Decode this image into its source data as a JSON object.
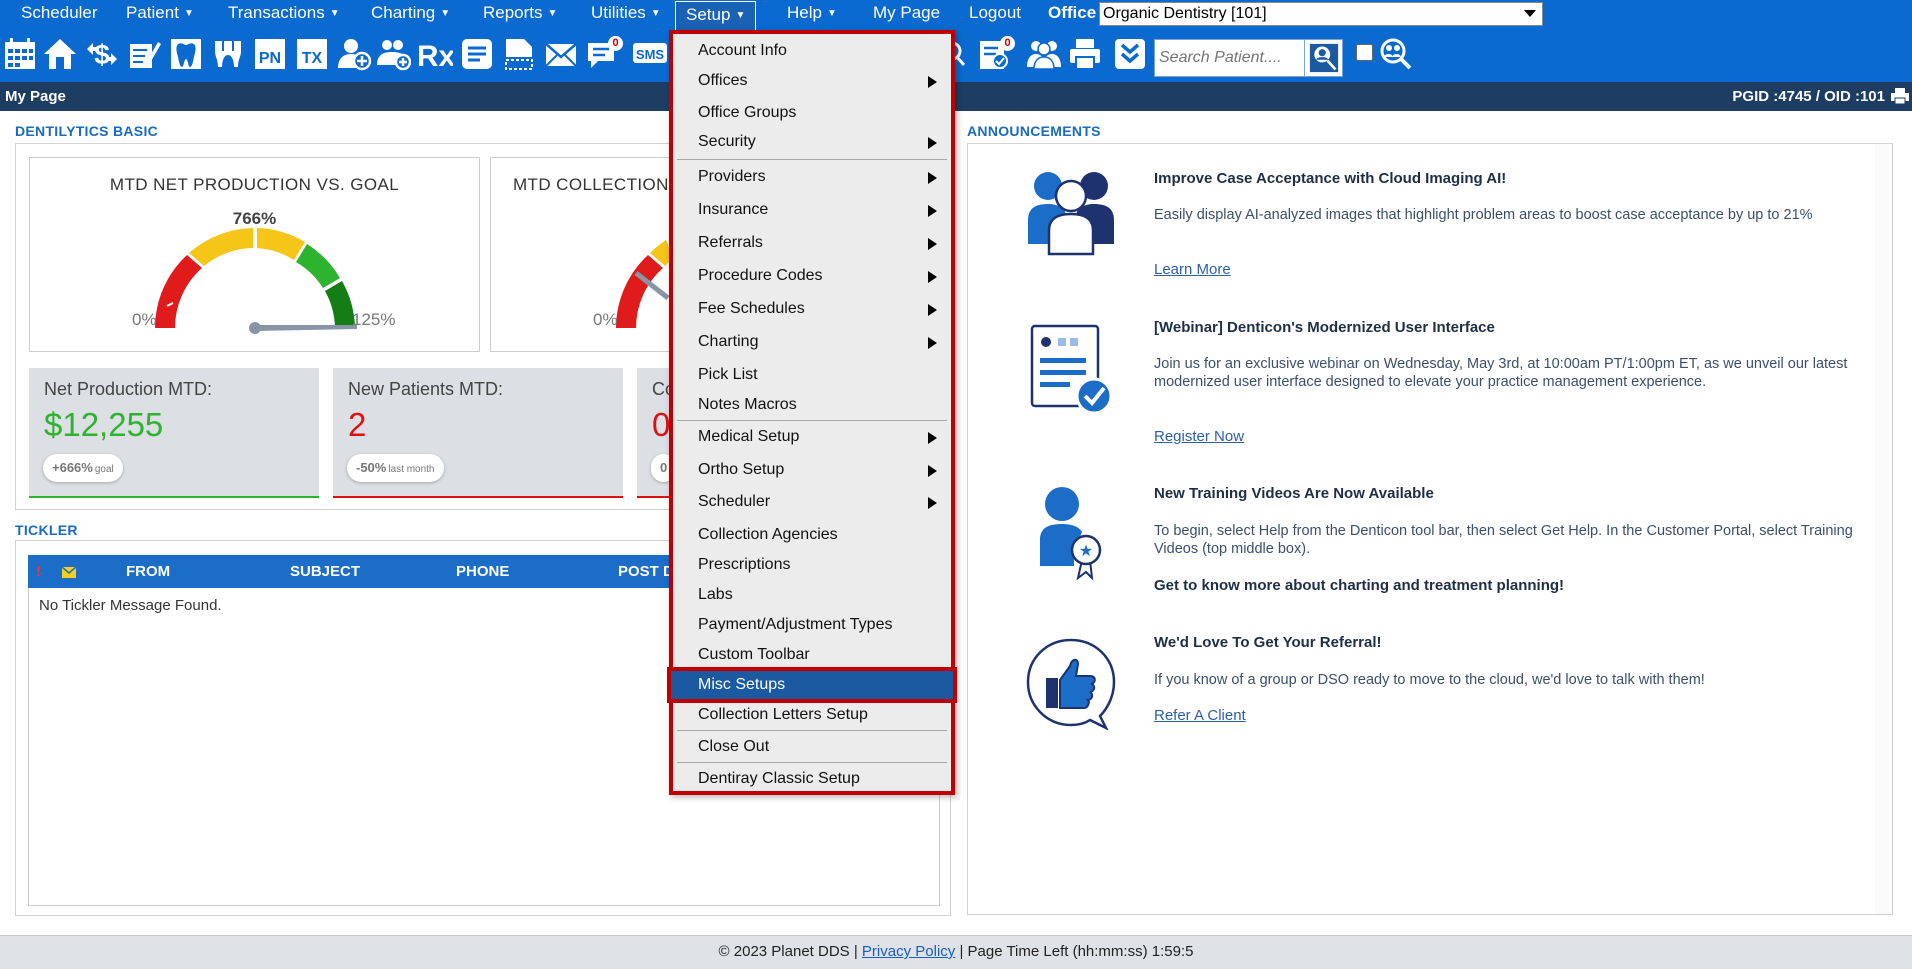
{
  "nav": {
    "items": [
      {
        "label": "Scheduler",
        "caret": false
      },
      {
        "label": "Patient",
        "caret": true
      },
      {
        "label": "Transactions",
        "caret": true
      },
      {
        "label": "Charting",
        "caret": true
      },
      {
        "label": "Reports",
        "caret": true
      },
      {
        "label": "Utilities",
        "caret": true
      },
      {
        "label": "Setup",
        "caret": true
      },
      {
        "label": "Help",
        "caret": true
      },
      {
        "label": "My Page",
        "caret": false
      },
      {
        "label": "Logout",
        "caret": false
      }
    ],
    "caret_glyph": "▼",
    "office_label": "Office",
    "office_value": "Organic Dentistry [101]"
  },
  "toolbar": {
    "icons": [
      "calendar-icon",
      "home-icon",
      "dollar-exchange-icon",
      "clipboard-pencil-icon",
      "tooth-icon",
      "teeth-icon",
      "pn-icon",
      "tx-icon",
      "add-patient-icon",
      "add-family-icon",
      "rx-icon",
      "notes-icon",
      "document-icon",
      "mail-icon",
      "messages-icon",
      "sms-icon"
    ],
    "pn_text": "PN",
    "tx_text": "TX",
    "rx_text": "Rx",
    "sms_text": "SMS",
    "messages_badge": "0",
    "tasks_badge": "0",
    "search_placeholder": "Search Patient...."
  },
  "page": {
    "title": "My Page",
    "ids": "PGID :4745  /  OID :101"
  },
  "dashboard": {
    "section_title": "DENTILYTICS BASIC",
    "gauges": [
      {
        "title": "MTD NET PRODUCTION VS. GOAL",
        "percent": "766%",
        "min": "0%",
        "max": "125%"
      },
      {
        "title": "MTD COLLECTION",
        "percent": "",
        "min": "0%",
        "max": ""
      }
    ],
    "stats": [
      {
        "label": "Net Production MTD:",
        "value": "$12,255",
        "pill_value": "+666%",
        "pill_suffix": "goal",
        "color": "#2db32d"
      },
      {
        "label": "New Patients MTD:",
        "value": "2",
        "pill_value": "-50%",
        "pill_suffix": "last month",
        "color": "#e01010"
      },
      {
        "label": "Co",
        "value": "0",
        "pill_value": "0",
        "pill_suffix": "",
        "color": "#e01010"
      }
    ]
  },
  "tickler": {
    "section_title": "TICKLER",
    "flag": "!",
    "columns": [
      "FROM",
      "SUBJECT",
      "PHONE",
      "POST D"
    ],
    "empty_message": "No Tickler Message Found."
  },
  "announcements": {
    "section_title": "ANNOUNCEMENTS",
    "items": [
      {
        "icon": "team-icon",
        "title": "Improve Case Acceptance with Cloud Imaging AI!",
        "text": "Easily display AI-analyzed images that highlight problem areas to boost case acceptance by up to 21%",
        "link": "Learn More"
      },
      {
        "icon": "checklist-icon",
        "title": "[Webinar] Denticon's Modernized User Interface",
        "text": "Join us for an exclusive webinar on Wednesday, May 3rd, at 10:00am PT/1:00pm ET, as we unveil our latest modernized user interface designed to elevate your practice management experience.",
        "link": "Register Now"
      },
      {
        "icon": "award-person-icon",
        "title": "New Training Videos Are Now Available",
        "text": "To begin, select Help from the Denticon tool bar, then select Get Help. In the Customer Portal, select Training Videos (top middle box).",
        "strong": "Get to know more about charting and treatment planning!"
      },
      {
        "icon": "thumbs-up-icon",
        "title": "We'd Love To Get Your Referral!",
        "text": "If you know of a group or DSO ready to move to the cloud, we'd love to talk with them!",
        "link": "Refer A Client"
      }
    ]
  },
  "setup_menu": {
    "items": [
      {
        "label": "Account Info",
        "submenu": false
      },
      {
        "label": "Offices",
        "submenu": true
      },
      {
        "label": "Office Groups",
        "submenu": false
      },
      {
        "label": "Security",
        "submenu": true
      },
      {
        "label": "Providers",
        "submenu": true
      },
      {
        "label": "Insurance",
        "submenu": true
      },
      {
        "label": "Referrals",
        "submenu": true
      },
      {
        "label": "Procedure Codes",
        "submenu": true
      },
      {
        "label": "Fee Schedules",
        "submenu": true
      },
      {
        "label": "Charting",
        "submenu": true
      },
      {
        "label": "Pick List",
        "submenu": false
      },
      {
        "label": "Notes Macros",
        "submenu": false
      },
      {
        "label": "Medical Setup",
        "submenu": true
      },
      {
        "label": "Ortho Setup",
        "submenu": true
      },
      {
        "label": "Scheduler",
        "submenu": true
      },
      {
        "label": "Collection Agencies",
        "submenu": false
      },
      {
        "label": "Prescriptions",
        "submenu": false
      },
      {
        "label": "Labs",
        "submenu": false
      },
      {
        "label": "Payment/Adjustment Types",
        "submenu": false
      },
      {
        "label": "Custom Toolbar",
        "submenu": false
      },
      {
        "label": "Misc Setups",
        "submenu": false,
        "highlighted": true
      },
      {
        "label": "Collection Letters Setup",
        "submenu": false
      },
      {
        "label": "Close Out",
        "submenu": false
      },
      {
        "label": "Dentiray Classic Setup",
        "submenu": false
      }
    ]
  },
  "footer": {
    "copyright": "© 2023 Planet DDS |",
    "privacy": "Privacy Policy",
    "time_left": "|  Page Time Left (hh:mm:ss) 1:59:5"
  },
  "colors": {
    "nav_blue": "#0a6ad0",
    "highlight_red": "#c00000",
    "menu_select": "#1b5aa0"
  }
}
